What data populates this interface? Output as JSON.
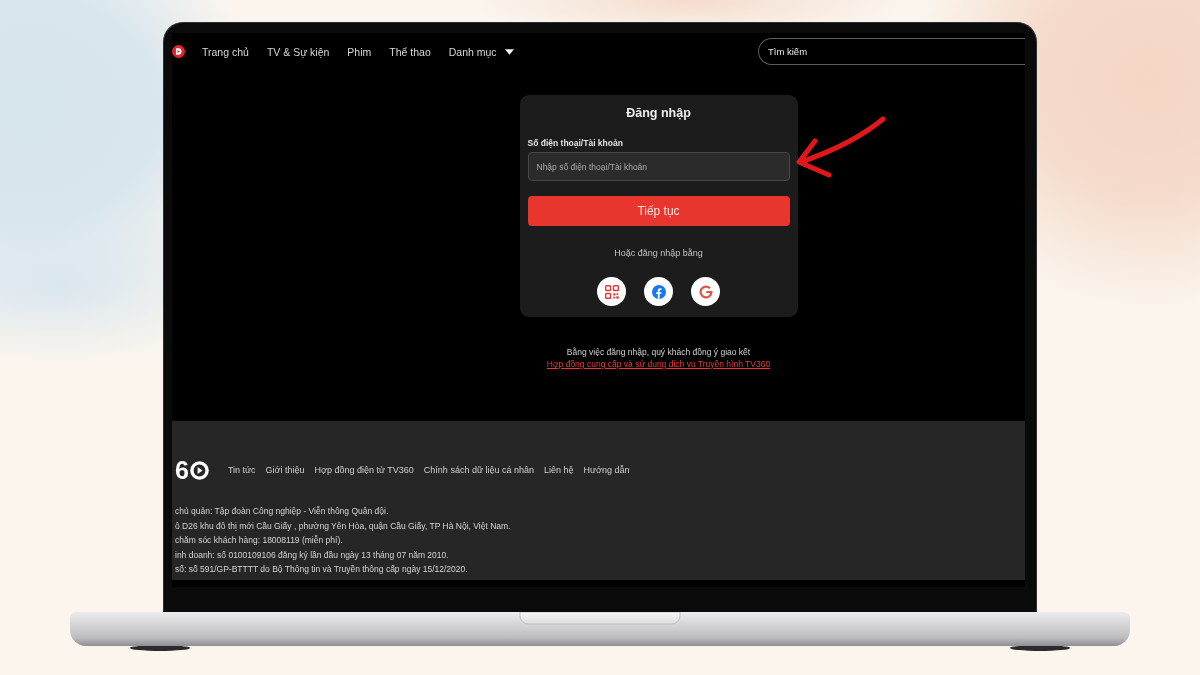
{
  "nav": {
    "links": [
      {
        "label": "Trang chủ",
        "kind": "link"
      },
      {
        "label": "TV & Sự kiện",
        "kind": "link"
      },
      {
        "label": "Phim",
        "kind": "link"
      },
      {
        "label": "Thể thao",
        "kind": "link"
      },
      {
        "label": "Danh mục",
        "kind": "dropdown"
      }
    ],
    "search": {
      "placeholder": "Tìm kiếm"
    }
  },
  "login": {
    "title": "Đăng nhập",
    "field": {
      "label": "Số điện thoại/Tài khoản",
      "placeholder": "Nhập số điện thoại/Tài khoản"
    },
    "submit_button": "Tiếp tục",
    "alternative_label": "Hoặc đăng nhập bằng",
    "providers": [
      {
        "kind": "qr"
      },
      {
        "kind": "facebook"
      },
      {
        "kind": "google"
      }
    ]
  },
  "terms": {
    "text": "Bằng việc đăng nhập, quý khách đồng ý giao kết",
    "link": "Hợp đồng cung cấp và sử dụng dịch vụ Truyền hình TV360"
  },
  "footer": {
    "logo": "6",
    "links": [
      "Tin tức",
      "Giới thiệu",
      "Hợp đồng điện tử TV360",
      "Chính sách dữ liệu cá nhân",
      "Liên hệ",
      "Hướng dẫn"
    ],
    "info": [
      "chủ quản: Tập đoàn Công nghiệp - Viễn thông Quân đội.",
      "ô D26 khu đô thị mới Cầu Giấy , phường Yên Hòa, quận Cầu Giấy, TP Hà Nội, Việt Nam.",
      "chăm sóc khách hàng: 18008119 (miễn phí).",
      "inh doanh: số 0100109106 đăng ký lần đầu ngày 13 tháng 07 năm 2010.",
      "số: số 591/GP-BTTTT do Bộ Thông tin và Truyền thông cấp ngày 15/12/2020."
    ]
  }
}
